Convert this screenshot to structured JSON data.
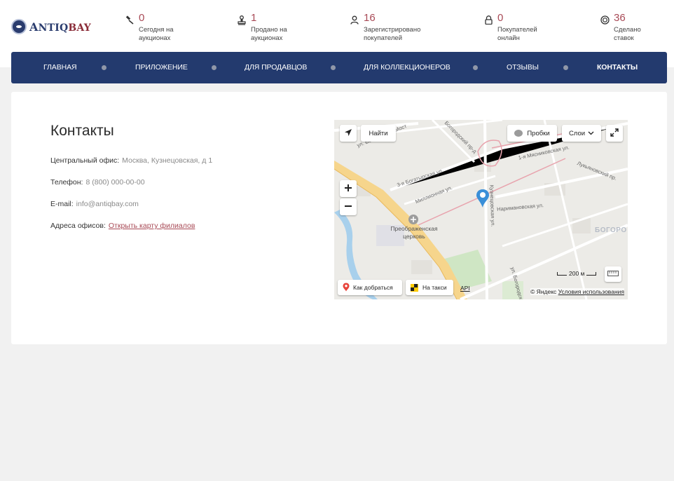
{
  "brand": {
    "prefix": "A",
    "name_part1": "NTIQ",
    "name_part2": "BAY",
    "colors": {
      "primary": "#233a6e",
      "accent": "#a84a56"
    }
  },
  "stats": [
    {
      "icon": "gavel-icon",
      "value": "0",
      "label": "Сегодня на аукционах"
    },
    {
      "icon": "stamp-icon",
      "value": "1",
      "label": "Продано на аукционах"
    },
    {
      "icon": "user-icon",
      "value": "16",
      "label": "Зарегистрировано покупателей"
    },
    {
      "icon": "lock-icon",
      "value": "0",
      "label": "Покупателей онлайн"
    },
    {
      "icon": "coins-icon",
      "value": "36",
      "label": "Сделано ставок"
    }
  ],
  "nav": [
    {
      "label": "Главная",
      "active": false
    },
    {
      "label": "Приложение",
      "active": false
    },
    {
      "label": "Для продавцов",
      "active": false
    },
    {
      "label": "Для коллекционеров",
      "active": false
    },
    {
      "label": "Отзывы",
      "active": false
    },
    {
      "label": "Контакты",
      "active": true
    }
  ],
  "contacts": {
    "title": "Контакты",
    "office_label": "Центральный офис:",
    "office_value": "Москва, Кузнецовская, д 1",
    "phone_label": "Телефон:",
    "phone_value": "8 (800) 000-00-00",
    "email_label": "E-mail:",
    "email_value": "info@antiqbay.com",
    "branches_label": "Адреса офисов:",
    "branches_link": "Открыть карту филиалов"
  },
  "map": {
    "find_label": "Найти",
    "traffic_label": "Пробки",
    "layers_label": "Слои",
    "route_label": "Как добраться",
    "taxi_label": "На такси",
    "api_label": "API",
    "scale_label": "200 м",
    "copyright_prefix": "© Яндекс",
    "terms_label": "Условия использования",
    "streets": [
      "ул. Богородский Мост",
      "Богородский пр-д",
      "3-я Богатырская ул.",
      "Миллионная ул.",
      "1-я Мясниковская ул.",
      "Лукьяновский пр.",
      "Кузнецовская ул.",
      "Наримановская ул.",
      "ул. Богородский Вал"
    ],
    "place_name": "Преображенская церковь",
    "district": "БОГОРО"
  }
}
